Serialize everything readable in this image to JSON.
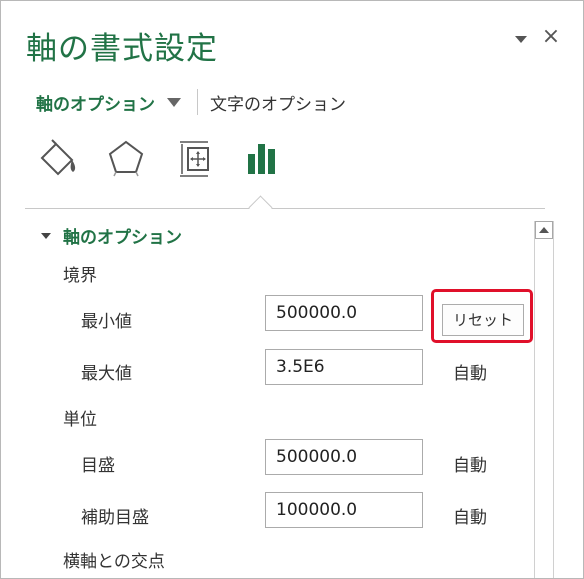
{
  "pane": {
    "title": "軸の書式設定",
    "close_label": "×"
  },
  "tabs": {
    "active_label": "軸のオプション",
    "other_label": "文字のオプション"
  },
  "icons": [
    "fill-line-icon",
    "effects-pentagon-icon",
    "size-properties-icon",
    "axis-options-bar-chart-icon"
  ],
  "section": {
    "title": "軸のオプション"
  },
  "bounds": {
    "label": "境界",
    "min": {
      "label": "最小値",
      "value": "500000.0",
      "action": "リセット"
    },
    "max": {
      "label": "最大値",
      "value": "3.5E6",
      "action": "自動"
    }
  },
  "units": {
    "label": "単位",
    "major": {
      "label": "目盛",
      "value": "500000.0",
      "action": "自動"
    },
    "minor": {
      "label": "補助目盛",
      "value": "100000.0",
      "action": "自動"
    }
  },
  "cross": {
    "label": "横軸との交点"
  },
  "colors": {
    "accent": "#217346",
    "highlight": "#e0102a"
  }
}
